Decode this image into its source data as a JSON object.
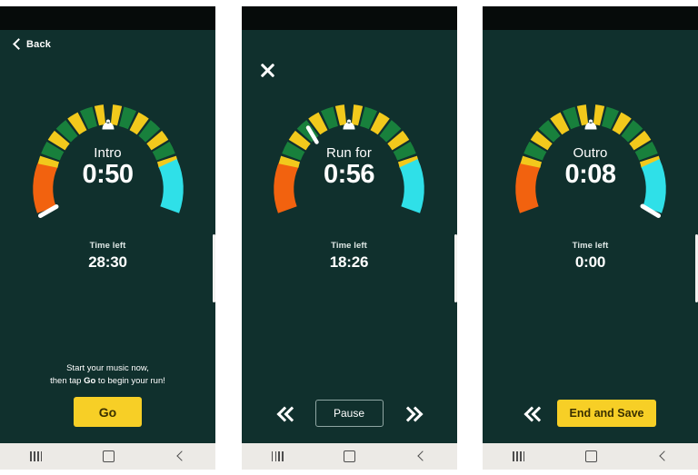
{
  "app": {
    "background_color": "#10302d",
    "statusbar_color": "#060b0a",
    "accent_yellow": "#f7cf26",
    "ring_colors": {
      "green": "#18803c",
      "yellow": "#f2c91c",
      "orange": "#f2620f",
      "cyan": "#2fe0e8",
      "marker": "#ffffff"
    }
  },
  "screens": [
    {
      "id": "intro",
      "header": {
        "back_label": "Back",
        "back_icon": "chevron-left-icon"
      },
      "gauge": {
        "bell_icon": "bell-icon",
        "marker_angle_deg": 212,
        "segments": "12 alternating green/yellow ticks across the top, orange arc at lower-left, cyan arc at lower-right"
      },
      "phase_label": "Intro",
      "phase_time": "0:50",
      "timeleft_label": "Time left",
      "timeleft_value": "28:30",
      "hint_line1": "Start your music now,",
      "hint_line2_pre": "then tap ",
      "hint_line2_strong": "Go",
      "hint_line2_post": " to begin your run!",
      "primary_button": "Go"
    },
    {
      "id": "run",
      "header": {
        "close_icon": "close-icon"
      },
      "gauge": {
        "bell_icon": "bell-icon",
        "marker_angle_deg": 300,
        "segments": "12 alternating green/yellow ticks across the top, orange arc at lower-left, cyan arc at lower-right"
      },
      "phase_label": "Run for",
      "phase_time": "0:56",
      "timeleft_label": "Time left",
      "timeleft_value": "18:26",
      "prev_icon": "double-chevron-left-icon",
      "next_icon": "double-chevron-right-icon",
      "primary_button": "Pause"
    },
    {
      "id": "outro",
      "header": {},
      "gauge": {
        "bell_icon": "bell-icon",
        "marker_angle_deg": 328,
        "segments": "12 alternating green/yellow ticks across the top, orange arc at lower-left, cyan arc at lower-right"
      },
      "phase_label": "Outro",
      "phase_time": "0:08",
      "timeleft_label": "Time left",
      "timeleft_value": "0:00",
      "prev_icon": "double-chevron-left-icon",
      "primary_button": "End and Save"
    }
  ],
  "navbar": {
    "recents_icon": "recents-icon",
    "home_icon": "home-icon",
    "back_icon": "back-icon"
  }
}
